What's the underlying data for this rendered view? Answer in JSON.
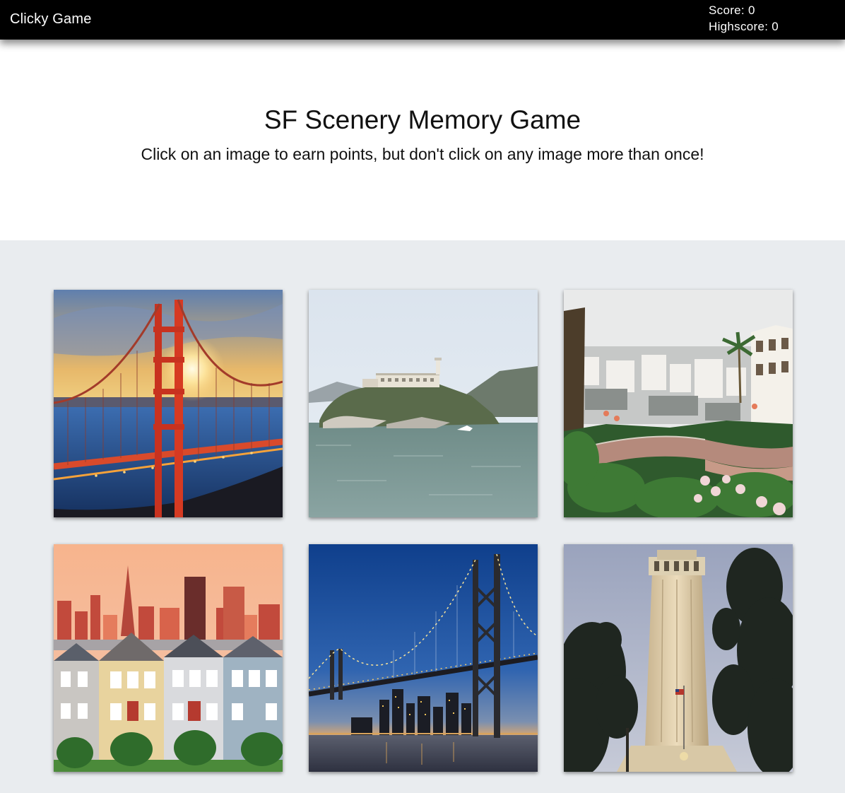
{
  "navbar": {
    "brand": "Clicky Game",
    "score_text": "Score: 0",
    "highscore_text": "Highscore: 0"
  },
  "hero": {
    "title": "SF Scenery Memory Game",
    "subtitle": "Click on an image to earn points, but don't click on any image more than once!"
  },
  "score": 0,
  "highscore": 0,
  "cards": [
    {
      "id": 1,
      "subject": "golden-gate-bridge-sunset"
    },
    {
      "id": 2,
      "subject": "alcatraz-island"
    },
    {
      "id": 3,
      "subject": "lombard-street"
    },
    {
      "id": 4,
      "subject": "painted-ladies"
    },
    {
      "id": 5,
      "subject": "bay-bridge-night"
    },
    {
      "id": 6,
      "subject": "coit-tower"
    }
  ],
  "colors": {
    "navbar_bg": "#000000",
    "navbar_text": "#ffffff",
    "hero_bg": "#ffffff",
    "grid_bg": "#e9ecef"
  }
}
